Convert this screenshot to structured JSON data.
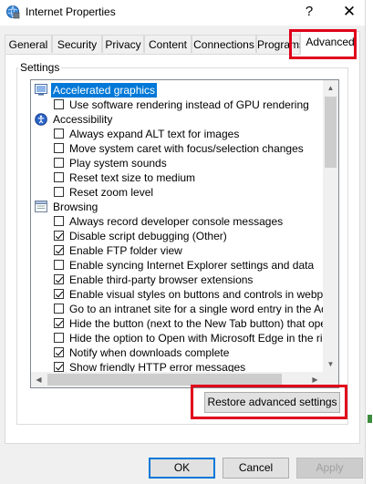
{
  "window": {
    "title": "Internet Properties",
    "help_label": "?",
    "close_label": "✕"
  },
  "tabs": [
    {
      "label": "General"
    },
    {
      "label": "Security"
    },
    {
      "label": "Privacy"
    },
    {
      "label": "Content"
    },
    {
      "label": "Connections"
    },
    {
      "label": "Programs"
    },
    {
      "label": "Advanced",
      "active": true
    }
  ],
  "settings": {
    "group_label": "Settings",
    "items": [
      {
        "kind": "category",
        "icon": "display-icon",
        "label": "Accelerated graphics",
        "selected": true
      },
      {
        "kind": "option",
        "label": "Use software rendering instead of GPU rendering",
        "checked": false
      },
      {
        "kind": "category",
        "icon": "accessibility-icon",
        "label": "Accessibility"
      },
      {
        "kind": "option",
        "label": "Always expand ALT text for images",
        "checked": false
      },
      {
        "kind": "option",
        "label": "Move system caret with focus/selection changes",
        "checked": false
      },
      {
        "kind": "option",
        "label": "Play system sounds",
        "checked": false
      },
      {
        "kind": "option",
        "label": "Reset text size to medium",
        "checked": false
      },
      {
        "kind": "option",
        "label": "Reset zoom level",
        "checked": false
      },
      {
        "kind": "category",
        "icon": "browsing-icon",
        "label": "Browsing"
      },
      {
        "kind": "option",
        "label": "Always record developer console messages",
        "checked": false
      },
      {
        "kind": "option",
        "label": "Disable script debugging (Other)",
        "checked": true
      },
      {
        "kind": "option",
        "label": "Enable FTP folder view",
        "checked": true
      },
      {
        "kind": "option",
        "label": "Enable syncing Internet Explorer settings and data",
        "checked": false
      },
      {
        "kind": "option",
        "label": "Enable third-party browser extensions",
        "checked": true
      },
      {
        "kind": "option",
        "label": "Enable visual styles on buttons and controls in webpages",
        "checked": true
      },
      {
        "kind": "option",
        "label": "Go to an intranet site for a single word entry in the Addres",
        "checked": false
      },
      {
        "kind": "option",
        "label": "Hide the button (next to the New Tab button) that opens",
        "checked": true
      },
      {
        "kind": "option",
        "label": "Hide the option to Open with Microsoft Edge in the right-cl",
        "checked": false
      },
      {
        "kind": "option",
        "label": "Notify when downloads complete",
        "checked": true
      },
      {
        "kind": "option",
        "label": "Show friendly HTTP error messages",
        "checked": true
      }
    ]
  },
  "restore_button": {
    "label": "Restore advanced settings"
  },
  "footer": {
    "ok_label": "OK",
    "cancel_label": "Cancel",
    "apply_label": "Apply",
    "apply_disabled": true
  }
}
